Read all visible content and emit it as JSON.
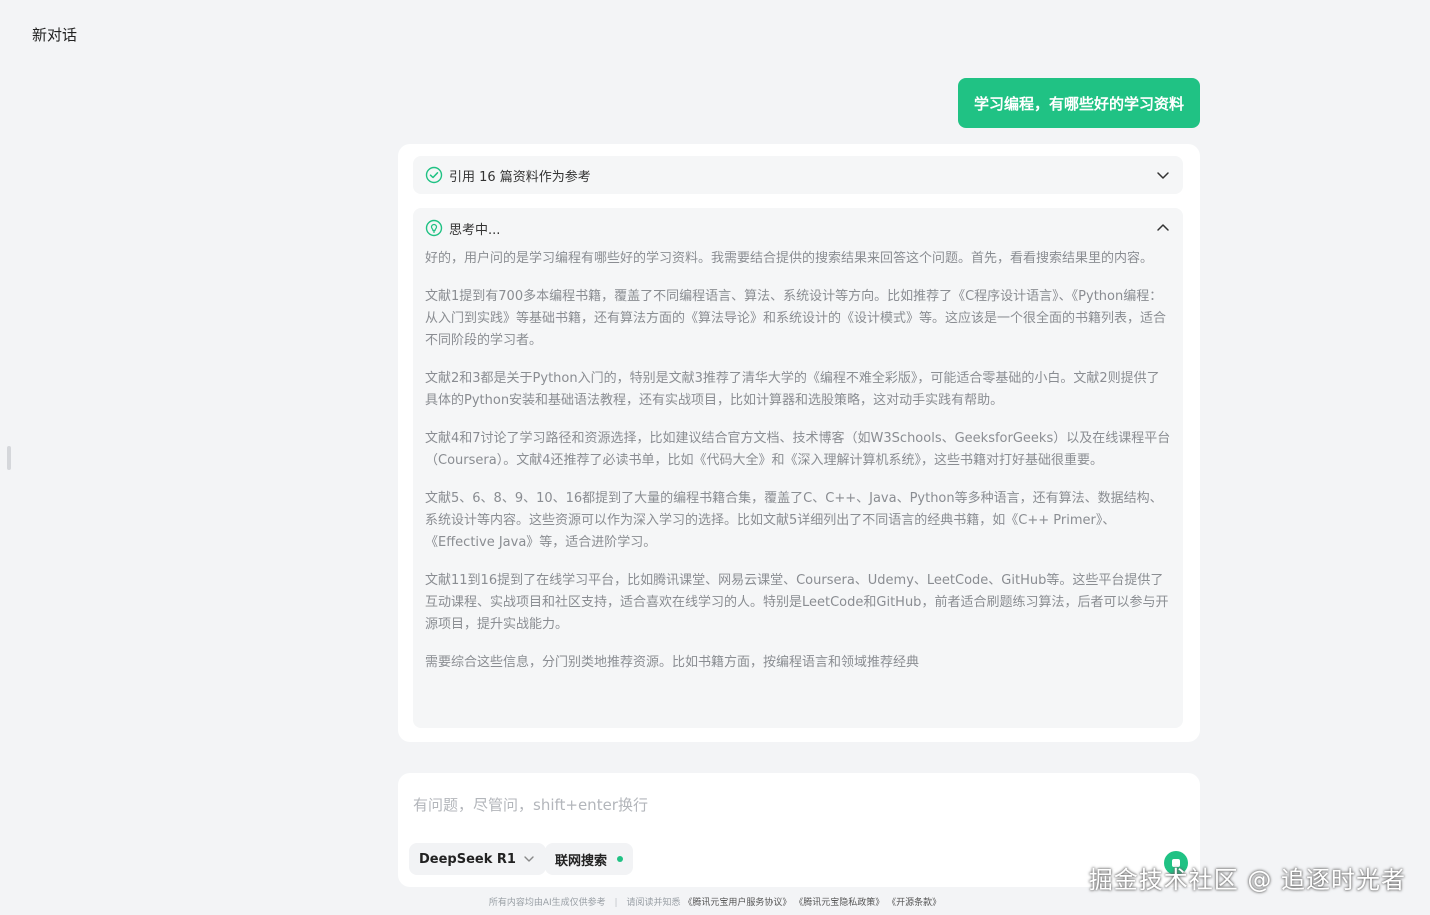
{
  "header": {
    "title": "新对话"
  },
  "user_message": {
    "text": "学习编程，有哪些好的学习资料"
  },
  "answer": {
    "references_label": "引用 16 篇资料作为参考",
    "thinking_label": "思考中...",
    "thinking_paragraphs": [
      "好的，用户问的是学习编程有哪些好的学习资料。我需要结合提供的搜索结果来回答这个问题。首先，看看搜索结果里的内容。",
      "文献1提到有700多本编程书籍，覆盖了不同编程语言、算法、系统设计等方向。比如推荐了《C程序设计语言》、《Python编程：从入门到实践》等基础书籍，还有算法方面的《算法导论》和系统设计的《设计模式》等。这应该是一个很全面的书籍列表，适合不同阶段的学习者。",
      "文献2和3都是关于Python入门的，特别是文献3推荐了清华大学的《编程不难全彩版》，可能适合零基础的小白。文献2则提供了具体的Python安装和基础语法教程，还有实战项目，比如计算器和选股策略，这对动手实践有帮助。",
      "文献4和7讨论了学习路径和资源选择，比如建议结合官方文档、技术博客（如W3Schools、GeeksforGeeks）以及在线课程平台（Coursera）。文献4还推荐了必读书单，比如《代码大全》和《深入理解计算机系统》，这些书籍对打好基础很重要。",
      "文献5、6、8、9、10、16都提到了大量的编程书籍合集，覆盖了C、C++、Java、Python等多种语言，还有算法、数据结构、系统设计等内容。这些资源可以作为深入学习的选择。比如文献5详细列出了不同语言的经典书籍，如《C++ Primer》、《Effective Java》等，适合进阶学习。",
      "文献11到16提到了在线学习平台，比如腾讯课堂、网易云课堂、Coursera、Udemy、LeetCode、GitHub等。这些平台提供了互动课程、实战项目和社区支持，适合喜欢在线学习的人。特别是LeetCode和GitHub，前者适合刷题练习算法，后者可以参与开源项目，提升实战能力。",
      "需要综合这些信息，分门别类地推荐资源。比如书籍方面，按编程语言和领域推荐经典"
    ]
  },
  "composer": {
    "placeholder": "有问题，尽管问，shift+enter换行",
    "model_label": "DeepSeek R1",
    "search_label": "联网搜索"
  },
  "footer": {
    "prefix": "所有内容均由AI生成仅供参考",
    "read_prefix": "请阅读并知悉",
    "links": [
      "《腾讯元宝用户服务协议》",
      "《腾讯元宝隐私政策》",
      "《开源条款》"
    ]
  },
  "watermark": {
    "text": "掘金技术社区 @ 追逐时光者"
  },
  "colors": {
    "accent": "#20c284",
    "background": "#f3f4f6"
  },
  "icons": {
    "references": "check-circle-icon",
    "thinking": "bulb-icon",
    "collapse": "chevron-down-icon",
    "expand": "chevron-up-icon"
  }
}
